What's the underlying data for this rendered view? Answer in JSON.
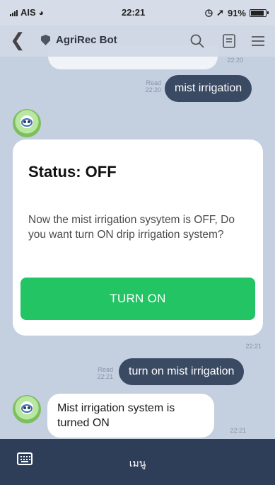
{
  "status_bar": {
    "carrier": "AIS",
    "time": "22:21",
    "battery": "91%",
    "battery_level": 0.91
  },
  "header": {
    "title": "AgriRec Bot"
  },
  "messages": {
    "top_in_time": "22:20",
    "out_1": {
      "text": "mist irrigation",
      "read": "Read",
      "time": "22:20"
    },
    "card": {
      "title": "Status: OFF",
      "body": "Now the mist irrigation sysytem is OFF, Do you want turn ON drip irrigation system?",
      "button": "TURN ON",
      "time": "22:21"
    },
    "out_2": {
      "text": "turn on mist irrigation",
      "read": "Read",
      "time": "22:21"
    },
    "in_last": {
      "text": "Mist irrigation system is turned ON",
      "time": "22:21"
    }
  },
  "footer": {
    "menu_label": "เมนู"
  }
}
